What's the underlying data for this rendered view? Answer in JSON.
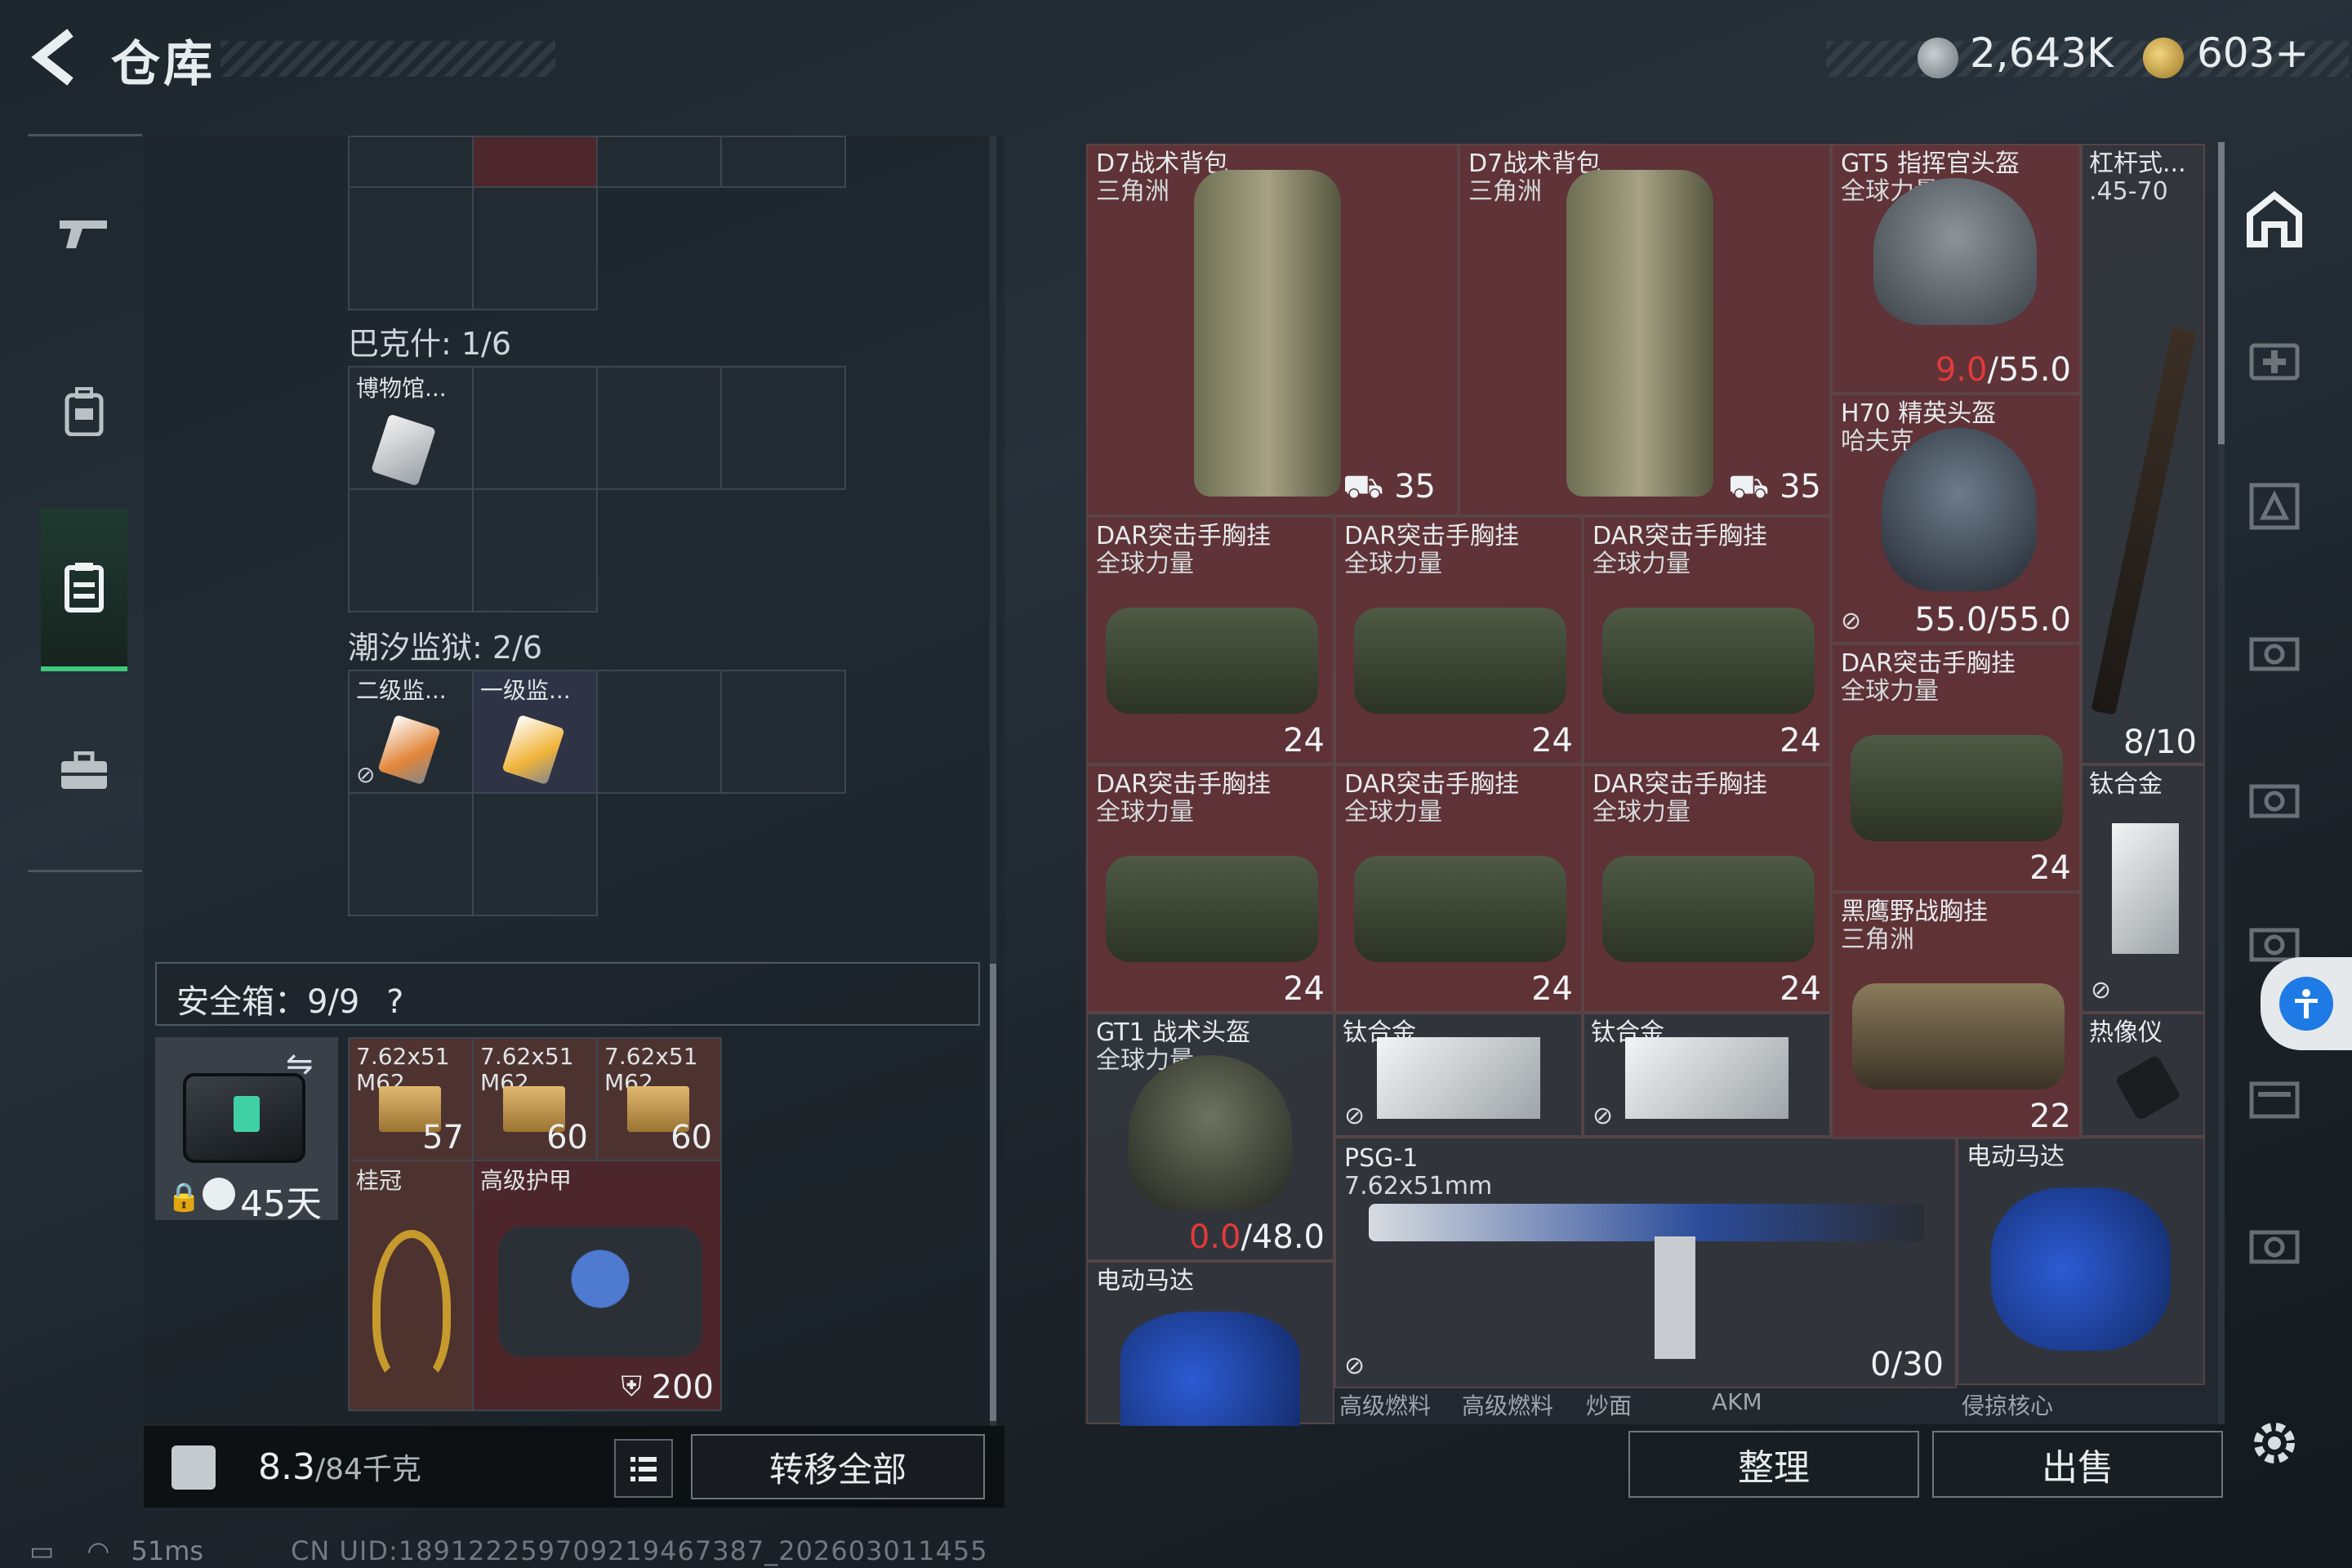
{
  "header": {
    "title": "仓库",
    "currency_1": "2,643K",
    "currency_2": "603+"
  },
  "nav": {
    "items": [
      "weapons-icon",
      "backpack-icon",
      "storage-icon",
      "toolbox-icon"
    ],
    "active": "storage-icon"
  },
  "stash": {
    "bakshi_label": "巴克什: 1/6",
    "bakshi_item_1": "博物馆...",
    "tidal_label": "潮汐监狱: 2/6",
    "tidal_item_1": "二级监...",
    "tidal_item_2": "一级监..."
  },
  "safe": {
    "label": "安全箱：9/9",
    "help": "?",
    "timer": "45天",
    "items": [
      {
        "name": "7.62x51",
        "sub": "M62",
        "count": "57"
      },
      {
        "name": "7.62x51",
        "sub": "M62",
        "count": "60"
      },
      {
        "name": "7.62x51",
        "sub": "M62",
        "count": "60"
      }
    ],
    "crown": "桂冠",
    "armor": "高级护甲",
    "armor_val": "200"
  },
  "bottom_left": {
    "weight_value": "8.3",
    "weight_total": "/84千克",
    "transfer_all": "转移全部"
  },
  "inventory": {
    "d7_1": {
      "name": "D7战术背包",
      "sub": "三角洲",
      "val": "35"
    },
    "d7_2": {
      "name": "D7战术背包",
      "sub": "三角洲",
      "val": "35"
    },
    "gt5": {
      "name": "GT5 指挥官头盔",
      "sub": "全球力量",
      "cur": "9.0",
      "max": "/55.0"
    },
    "lever": {
      "name": "杠杆式...",
      "sub": ".45-70",
      "val": "8/10"
    },
    "h70": {
      "name": "H70 精英头盔",
      "sub": "哈夫克",
      "val": "55.0/55.0"
    },
    "dar": {
      "name": "DAR突击手胸挂",
      "sub": "全球力量",
      "val": "24"
    },
    "titanium": "钛合金",
    "heagle": {
      "name": "黑鹰野战胸挂",
      "sub": "三角洲",
      "val": "22"
    },
    "gt1": {
      "name": "GT1 战术头盔",
      "sub": "全球力量",
      "cur": "0.0",
      "max": "/48.0"
    },
    "thermal": "热像仪",
    "psg": {
      "name": "PSG-1",
      "sub": "7.62x51mm",
      "val": "0/30"
    },
    "motor": "电动马达",
    "bottom_row": [
      "高级燃料",
      "高级燃料",
      "炒面",
      "AKM",
      "侵掠核心"
    ]
  },
  "buttons": {
    "sort": "整理",
    "sell": "出售"
  },
  "status": {
    "ping": "51ms",
    "uid": "CN UID:18912225970921946738​7_202603011455"
  }
}
